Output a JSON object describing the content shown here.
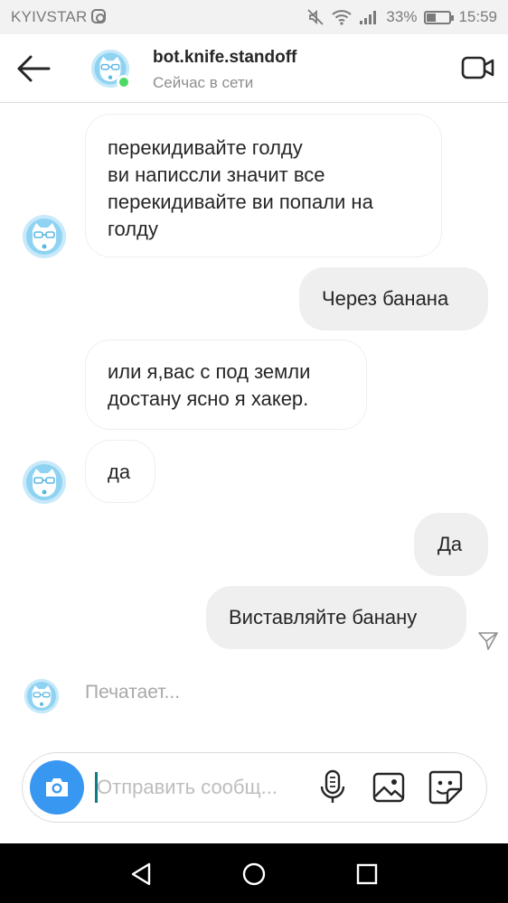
{
  "status_bar": {
    "carrier": "KYIVSTAR",
    "battery": "33%",
    "time": "15:59"
  },
  "header": {
    "contact_name": "bot.knife.standoff",
    "contact_status": "Сейчас в сети",
    "online_color": "#4cd964"
  },
  "messages": [
    {
      "direction": "incoming",
      "lines": [
        "перекидивайте голду",
        "ви написсли значит все",
        "перекидивайте ви попали на",
        "голду"
      ]
    },
    {
      "direction": "outgoing",
      "lines": [
        "Через банана"
      ]
    },
    {
      "direction": "incoming",
      "lines": [
        "или я,вас с под земли",
        "достану ясно я хакер."
      ]
    },
    {
      "direction": "incoming",
      "lines": [
        "да"
      ]
    },
    {
      "direction": "outgoing",
      "lines": [
        "Да"
      ]
    },
    {
      "direction": "outgoing",
      "lines": [
        "Виставляйте банану"
      ]
    }
  ],
  "typing_indicator": "Печатает...",
  "composer": {
    "placeholder": "Отправить сообщ...",
    "camera_color": "#3897f0"
  },
  "icons": {
    "back": "arrow-left-icon",
    "video": "video-camera-icon",
    "seen": "paper-plane-icon",
    "camera": "camera-icon",
    "mic": "microphone-icon",
    "gallery": "image-icon",
    "sticker": "sticker-icon",
    "nav": [
      "triangle-back-icon",
      "circle-home-icon",
      "square-recents-icon"
    ]
  }
}
